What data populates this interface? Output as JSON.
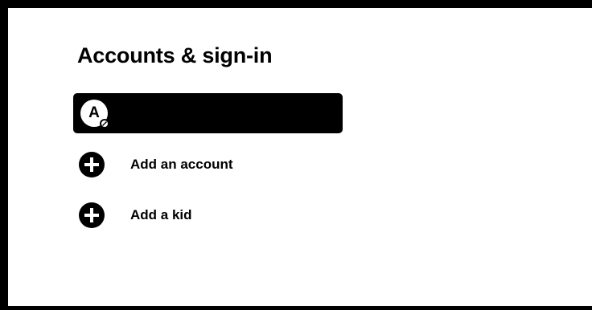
{
  "page": {
    "title": "Accounts & sign-in"
  },
  "account": {
    "avatar_letter": "A",
    "name": ""
  },
  "actions": [
    {
      "label": "Add an account",
      "icon": "plus-circle-icon"
    },
    {
      "label": "Add a kid",
      "icon": "plus-circle-icon"
    }
  ],
  "colors": {
    "background": "#000000",
    "panel": "#ffffff",
    "selected_row": "#000000",
    "text": "#000000"
  }
}
